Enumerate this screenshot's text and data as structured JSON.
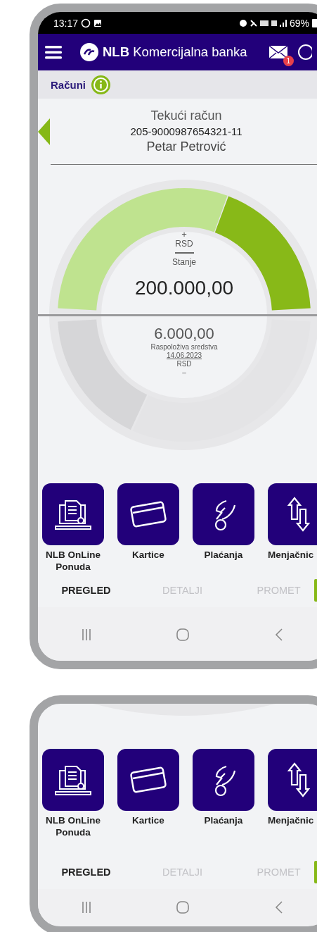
{
  "screen_1": {
    "status_bar": {
      "time": "13:17",
      "battery": "69%"
    },
    "header": {
      "brand": "NLB Komercijalna banka",
      "badge": "1"
    },
    "section": {
      "title": "Računi"
    },
    "account": {
      "type": "Tekući račun",
      "number": "205-9000987654321-11",
      "owner": "Petar Petrović"
    },
    "balance": {
      "sign": "+",
      "currency": "RSD",
      "label": "Stanje",
      "amount": "200.000,00"
    },
    "available": {
      "amount": "6.000,00",
      "label": "Raspoloživa sredstva",
      "date": "14.06.2023",
      "currency": "RSD",
      "dash": "–"
    },
    "tiles": [
      {
        "kind": "offer",
        "label": "NLB OnLine Ponuda"
      },
      {
        "kind": "cards",
        "label": "Kartice"
      },
      {
        "kind": "payments",
        "label": "Plaćanja"
      },
      {
        "kind": "exchange",
        "label": "Menjačnic"
      }
    ],
    "tabs": [
      {
        "label": "PREGLED",
        "selected": true
      },
      {
        "label": "DETALJI",
        "selected": false
      },
      {
        "label": "PROMET",
        "selected": false
      }
    ]
  },
  "screen_2": {
    "tiles": [
      {
        "kind": "offer",
        "label": "NLB OnLine Ponuda"
      },
      {
        "kind": "cards",
        "label": "Kartice"
      },
      {
        "kind": "payments",
        "label": "Plaćanja"
      },
      {
        "kind": "exchange",
        "label": "Menjačnic"
      }
    ],
    "tabs": [
      {
        "label": "PREGLED",
        "selected": true
      },
      {
        "label": "DETALJI",
        "selected": false
      },
      {
        "label": "PROMET",
        "selected": false
      }
    ]
  }
}
